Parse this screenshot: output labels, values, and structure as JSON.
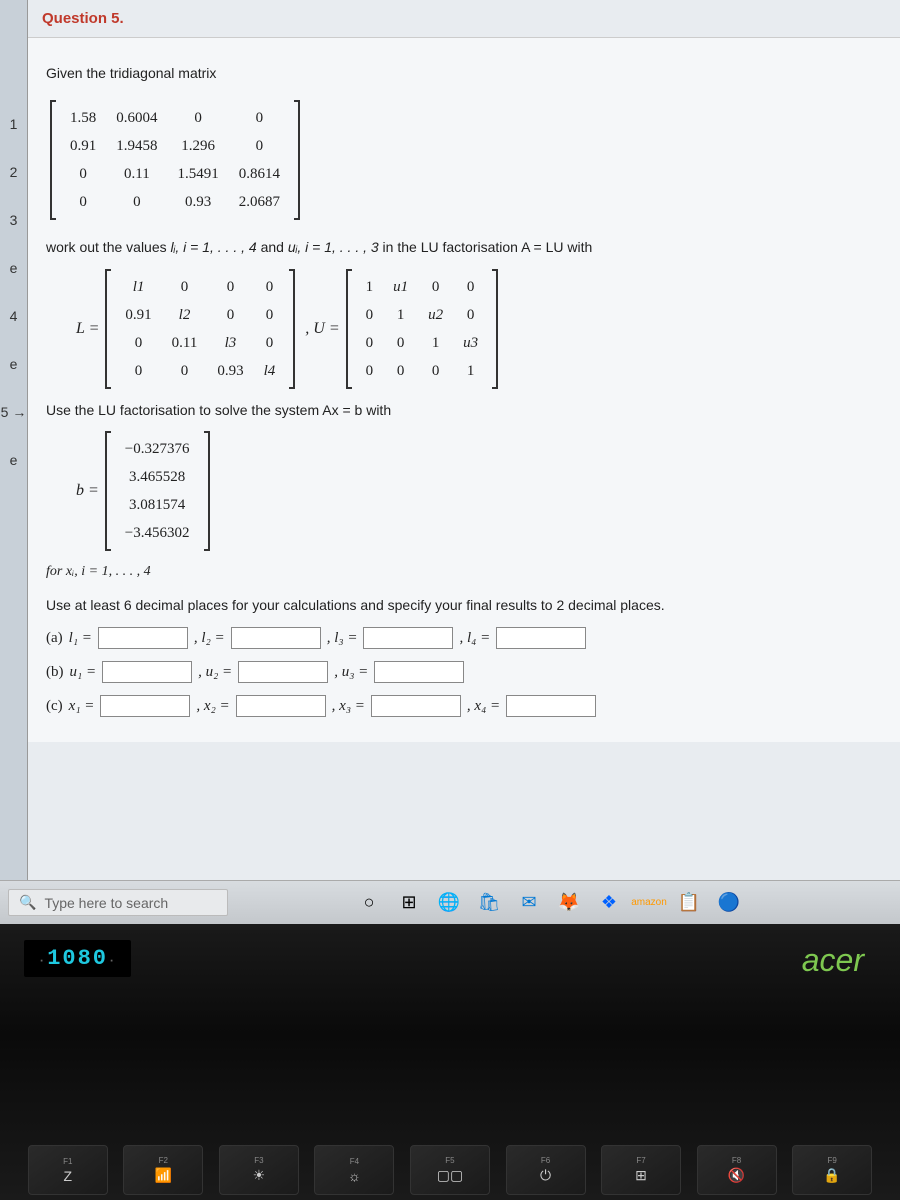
{
  "sidebar": {
    "items": [
      "1",
      "2",
      "3",
      "e",
      "4",
      "e",
      "5 →",
      "e"
    ]
  },
  "question": {
    "title": "Question 5.",
    "intro": "Given the tridiagonal matrix",
    "matrix_A": [
      [
        "1.58",
        "0.6004",
        "0",
        "0"
      ],
      [
        "0.91",
        "1.9458",
        "1.296",
        "0"
      ],
      [
        "0",
        "0.11",
        "1.5491",
        "0.8614"
      ],
      [
        "0",
        "0",
        "0.93",
        "2.0687"
      ]
    ],
    "workout_prefix": "work out the values ",
    "workout_li": "lᵢ, i = 1, . . . , 4",
    "workout_and": " and ",
    "workout_ui": "uᵢ, i = 1, . . . , 3",
    "workout_suffix": " in the LU factorisation A = LU with",
    "L_label": "L =",
    "matrix_L": [
      [
        "l1",
        "0",
        "0",
        "0"
      ],
      [
        "0.91",
        "l2",
        "0",
        "0"
      ],
      [
        "0",
        "0.11",
        "l3",
        "0"
      ],
      [
        "0",
        "0",
        "0.93",
        "l4"
      ]
    ],
    "U_label": ", U =",
    "matrix_U": [
      [
        "1",
        "u1",
        "0",
        "0"
      ],
      [
        "0",
        "1",
        "u2",
        "0"
      ],
      [
        "0",
        "0",
        "1",
        "u3"
      ],
      [
        "0",
        "0",
        "0",
        "1"
      ]
    ],
    "solve_text": "Use the LU factorisation to solve the system Ax = b with",
    "b_label": "b =",
    "vector_b": [
      "−0.327376",
      "3.465528",
      "3.081574",
      "−3.456302"
    ],
    "for_x": "for xᵢ, i = 1, . . . , 4",
    "precision": "Use at least 6 decimal places for your calculations and specify your final results to 2 decimal places.",
    "answers": {
      "a": {
        "prefix": "(a)",
        "labels": [
          "l₁ =",
          ", l₂ =",
          ", l₃ =",
          ", l₄ ="
        ]
      },
      "b": {
        "prefix": "(b)",
        "labels": [
          "u₁ =",
          ", u₂ =",
          ", u₃ ="
        ]
      },
      "c": {
        "prefix": "(c)",
        "labels": [
          "x₁ =",
          ", x₂ =",
          ", x₃ =",
          ", x₄ ="
        ]
      }
    }
  },
  "taskbar": {
    "search_placeholder": "Type here to search"
  },
  "laptop": {
    "model": "1080",
    "brand": "acer",
    "fkeys": [
      "F1",
      "F2",
      "F3",
      "F4",
      "F5",
      "F6",
      "F7",
      "F8",
      "F9"
    ]
  }
}
